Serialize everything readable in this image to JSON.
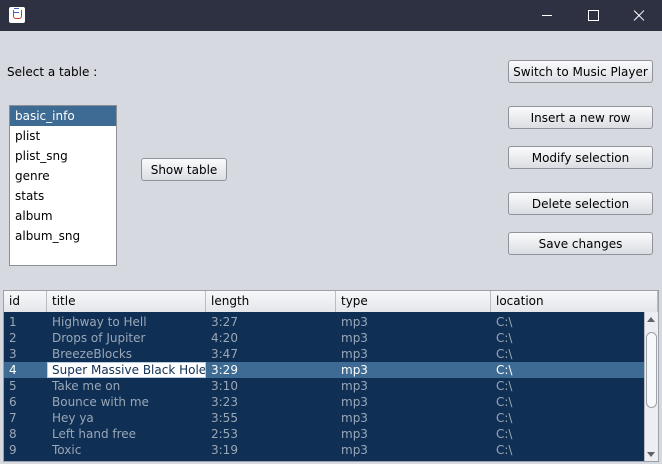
{
  "window": {
    "icon": "java-cup-icon",
    "controls": [
      "minimize-icon",
      "maximize-icon",
      "close-icon"
    ]
  },
  "select_label": "Select a table :",
  "tables": [
    "basic_info",
    "plist",
    "plist_sng",
    "genre",
    "stats",
    "album",
    "album_sng"
  ],
  "selected_table": "basic_info",
  "buttons": {
    "show_table": "Show table",
    "switch_player": "Switch to Music Player",
    "insert_row": "Insert a new row",
    "modify_selection": "Modify selection",
    "delete_selection": "Delete selection",
    "save_changes": "Save changes"
  },
  "table": {
    "columns": [
      "id",
      "title",
      "length",
      "type",
      "location"
    ],
    "rows": [
      [
        "1",
        "Highway to Hell",
        "3:27",
        "mp3",
        "C:\\"
      ],
      [
        "2",
        "Drops of Jupiter",
        "4:20",
        "mp3",
        "C:\\"
      ],
      [
        "3",
        "BreezeBlocks",
        "3:47",
        "mp3",
        "C:\\"
      ],
      [
        "4",
        "Super Massive Black Hole",
        "3:29",
        "mp3",
        "C:\\"
      ],
      [
        "5",
        "Take me on",
        "3:10",
        "mp3",
        "C:\\"
      ],
      [
        "6",
        "Bounce with me",
        "3:23",
        "mp3",
        "C:\\"
      ],
      [
        "7",
        "Hey ya",
        "3:55",
        "mp3",
        "C:\\"
      ],
      [
        "8",
        "Left hand free",
        "2:53",
        "mp3",
        "C:\\"
      ],
      [
        "9",
        "Toxic",
        "3:19",
        "mp3",
        "C:\\"
      ]
    ],
    "selected_row": "4"
  },
  "colors": {
    "titlebar": "#2d3142",
    "selection": "#3d6b93",
    "table_background": "#0f2f54",
    "window_background": "#d6d9df"
  }
}
